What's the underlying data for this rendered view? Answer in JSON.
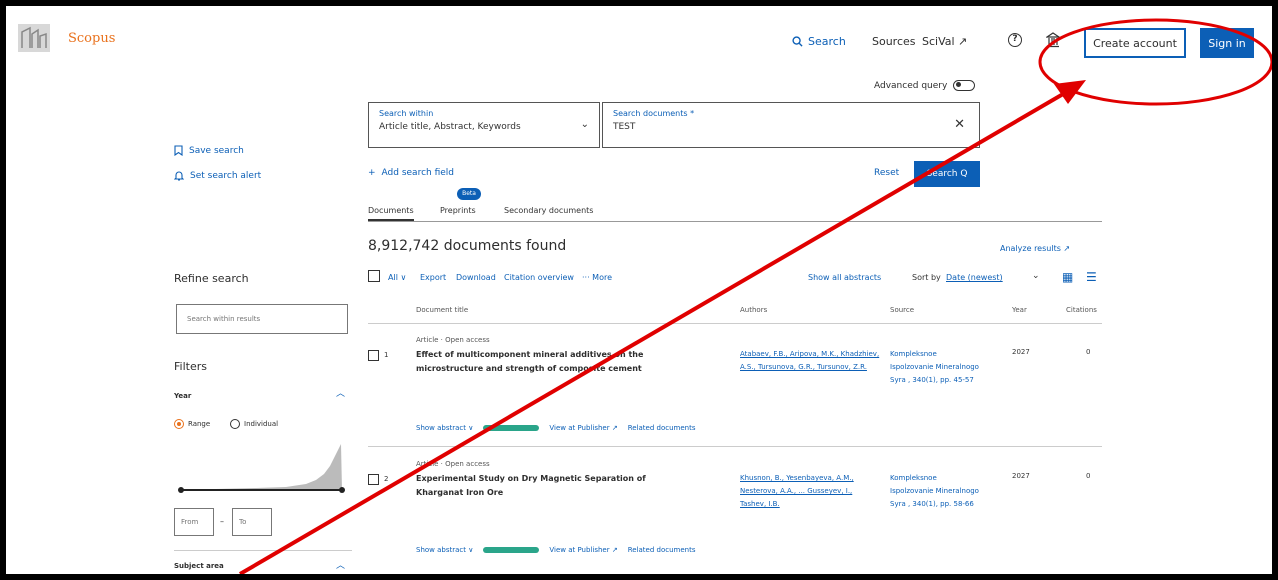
{
  "header": {
    "brand": "Scopus",
    "nav_search": "Search",
    "nav_sources": "Sources",
    "nav_scival": "SciVal ↗",
    "help_symbol": "?",
    "create_account": "Create account",
    "sign_in": "Sign in"
  },
  "search_form": {
    "advanced_query": "Advanced query",
    "within_label": "Search within",
    "within_value": "Article title, Abstract, Keywords",
    "docs_label": "Search documents *",
    "docs_value": "TEST",
    "add_field": "Add search field",
    "reset": "Reset",
    "search_button": "Search Q"
  },
  "left_actions": {
    "save_search": "Save search",
    "set_alert": "Set search alert"
  },
  "tabs": {
    "documents": "Documents",
    "preprints": "Preprints",
    "beta": "Beta",
    "secondary": "Secondary documents"
  },
  "results": {
    "count": "8,912,742 documents found",
    "analyze": "Analyze results ↗",
    "toolbar": {
      "all": "All ∨",
      "export": "Export",
      "download": "Download",
      "citation_overview": "Citation overview",
      "more": "··· More",
      "show_abstracts": "Show all abstracts",
      "sort_by": "Sort by",
      "sort_value": "Date (newest)"
    },
    "columns": {
      "title": "Document title",
      "authors": "Authors",
      "source": "Source",
      "year": "Year",
      "citations": "Citations"
    },
    "rows": [
      {
        "num": "1",
        "type": "Article · Open access",
        "title": "Effect of multicomponent mineral additives on the microstructure and strength of composite cement",
        "authors": "Atabaev, F.B., Aripova, M.K., Khadzhiev, A.S., Tursunova, G.R., Tursunov, Z.R.",
        "source": "Kompleksnoe Ispolzovanie Mineralnogo Syra , 340(1), pp. 45-57",
        "year": "2027",
        "citations": "0",
        "show_abstract": "Show abstract ∨",
        "view_publisher": "View at Publisher ↗",
        "related": "Related documents"
      },
      {
        "num": "2",
        "type": "Article · Open access",
        "title": "Experimental Study on Dry Magnetic Separation of Kharganat Iron Ore",
        "authors": "Khusnon, B., Yesenbayeva, A.M., Nesterova, A.A., ... Gusseyev, I., Tashev, I.B.",
        "source": "Kompleksnoe Ispolzovanie Mineralnogo Syra , 340(1), pp. 58-66",
        "year": "2027",
        "citations": "0",
        "show_abstract": "Show abstract ∨",
        "view_publisher": "View at Publisher ↗",
        "related": "Related documents"
      }
    ]
  },
  "sidebar": {
    "refine_title": "Refine search",
    "search_within_placeholder": "Search within results",
    "filters_title": "Filters",
    "year_label": "Year",
    "range": "Range",
    "individual": "Individual",
    "from_placeholder": "From",
    "to_placeholder": "To",
    "range_dash": "–",
    "subject_area": "Subject area"
  },
  "colors": {
    "accent_blue": "#0c5fb6",
    "brand_orange": "#e9711c",
    "annotation_red": "#e00000"
  },
  "icons": [
    "scopus-logo-icon",
    "search-icon",
    "help-icon",
    "institution-icon",
    "bookmark-icon",
    "bell-icon",
    "plus-icon",
    "clear-icon",
    "chevron-down-icon",
    "analyze-icon",
    "grid-view-icon",
    "list-view-icon"
  ]
}
